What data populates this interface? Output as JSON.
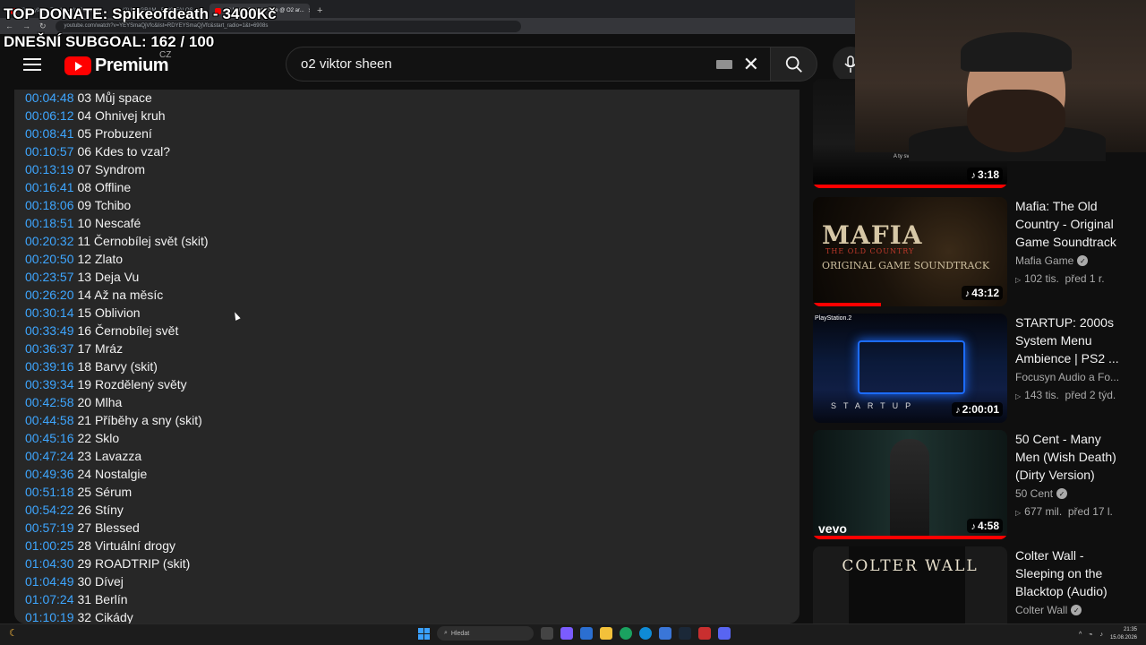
{
  "browser": {
    "tabs": [
      {
        "label": "(2) Kryštof - Zpátky - YouTube"
      },
      {
        "label": "(2) FLYGRAM - BUKEFALOS"
      },
      {
        "label": "(2) Viktor Sheen - Live @ O2 ar..."
      }
    ],
    "url": "youtube.com/watch?v=YEYSmaQjVfc&list=RDYEYSmaQjVfc&start_radio=1&t=6908s"
  },
  "overlay": {
    "top_donate": "TOP DONATE: Spikeofdeath - 3400Kč",
    "subgoal": "DNEŠNÍ SUBGOAL: 162 / 100"
  },
  "header": {
    "logo_text": "Premium",
    "country": "CZ",
    "search_value": "o2 viktor sheen",
    "icons": {
      "menu": "hamburger-menu-icon",
      "keyboard": "keyboard-icon",
      "clear": "close-icon",
      "search": "search-icon",
      "mic": "microphone-icon"
    }
  },
  "tracklist": [
    {
      "time": "00:04:48",
      "name": "03 Můj space"
    },
    {
      "time": "00:06:12",
      "name": "04 Ohnivej kruh"
    },
    {
      "time": "00:08:41",
      "name": "05 Probuzení"
    },
    {
      "time": "00:10:57",
      "name": "06 Kdes to vzal?"
    },
    {
      "time": "00:13:19",
      "name": "07 Syndrom"
    },
    {
      "time": "00:16:41",
      "name": "08 Offline"
    },
    {
      "time": "00:18:06",
      "name": "09 Tchibo"
    },
    {
      "time": "00:18:51",
      "name": "10 Nescafé"
    },
    {
      "time": "00:20:32",
      "name": "11 Černobílej svět (skit)"
    },
    {
      "time": "00:20:50",
      "name": "12 Zlato"
    },
    {
      "time": "00:23:57",
      "name": "13 Deja Vu"
    },
    {
      "time": "00:26:20",
      "name": "14 Až na měsíc"
    },
    {
      "time": "00:30:14",
      "name": "15 Oblivion"
    },
    {
      "time": "00:33:49",
      "name": "16 Černobílej svět"
    },
    {
      "time": "00:36:37",
      "name": "17 Mráz"
    },
    {
      "time": "00:39:16",
      "name": "18 Barvy (skit)"
    },
    {
      "time": "00:39:34",
      "name": "19 Rozdělený světy"
    },
    {
      "time": "00:42:58",
      "name": "20 Mlha"
    },
    {
      "time": "00:44:58",
      "name": "21 Příběhy a sny (skit)"
    },
    {
      "time": "00:45:16",
      "name": "22 Sklo"
    },
    {
      "time": "00:47:24",
      "name": "23 Lavazza"
    },
    {
      "time": "00:49:36",
      "name": "24 Nostalgie"
    },
    {
      "time": "00:51:18",
      "name": "25 Sérum"
    },
    {
      "time": "00:54:22",
      "name": "26 Stíny"
    },
    {
      "time": "00:57:19",
      "name": "27 Blessed"
    },
    {
      "time": "01:00:25",
      "name": "28 Virtuální drogy"
    },
    {
      "time": "01:04:30",
      "name": "29 ROADTRIP (skit)"
    },
    {
      "time": "01:04:49",
      "name": "30 Dívej"
    },
    {
      "time": "01:07:24",
      "name": "31 Berlín"
    },
    {
      "time": "01:10:19",
      "name": "32 Cikády"
    }
  ],
  "recommendations": [
    {
      "title": "",
      "channel": "",
      "views": "",
      "age": "",
      "duration": "3:18",
      "thumb_text": "A ty svět bez?",
      "progress": 1.0
    },
    {
      "title": "Mafia: The Old Country - Original Game Soundtrack",
      "channel": "Mafia Game",
      "verified": true,
      "views": "102 tis.",
      "age": "před 1 r.",
      "duration": "43:12",
      "thumb_text": "MAFIA",
      "thumb_sub": "THE OLD COUNTRY",
      "thumb_sub2": "ORIGINAL GAME SOUNDTRACK",
      "progress": 0.35
    },
    {
      "title": "STARTUP: 2000s System Menu Ambience | PS2 ...",
      "channel": "Focusyn Audio a Fo...",
      "verified": false,
      "views": "143 tis.",
      "age": "před 2 týd.",
      "duration": "2:00:01",
      "thumb_text": "PlayStation.2",
      "thumb_sub": "STARTUP",
      "progress": 0
    },
    {
      "title": "50 Cent - Many Men (Wish Death) (Dirty Version)",
      "channel": "50 Cent",
      "verified": true,
      "views": "677 mil.",
      "age": "před 17 l.",
      "duration": "4:58",
      "thumb_text": "vevo",
      "progress": 1.0
    },
    {
      "title": "Colter Wall - Sleeping on the Blacktop (Audio)",
      "channel": "Colter Wall",
      "verified": true,
      "views": "",
      "age": "",
      "duration": "",
      "thumb_text": "COLTER WALL",
      "progress": 0
    }
  ],
  "taskbar": {
    "search_placeholder": "Hledat",
    "time": "21:35",
    "date": "15.08.2026"
  }
}
